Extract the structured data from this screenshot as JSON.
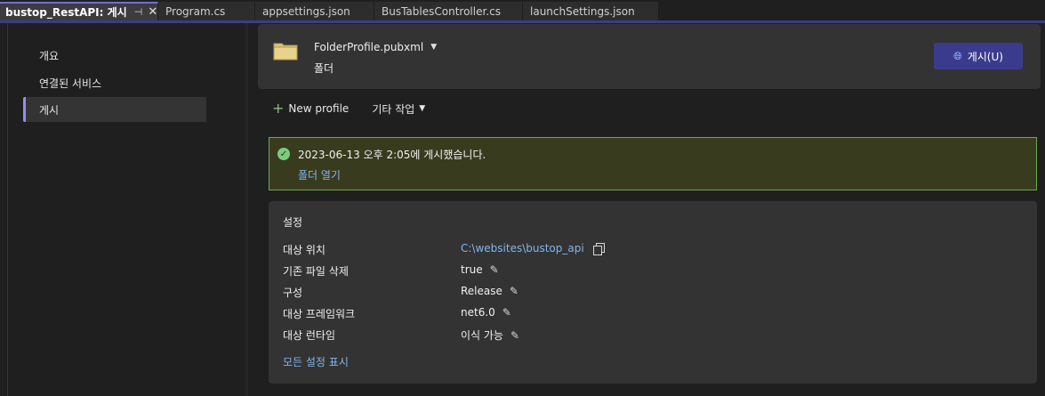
{
  "tabs": [
    {
      "label": "bustop_RestAPI: 게시",
      "active": true,
      "pin": "⊣",
      "close": "✕"
    },
    {
      "label": "Program.cs",
      "active": false
    },
    {
      "label": "appsettings.json",
      "active": false
    },
    {
      "label": "BusTablesController.cs",
      "active": false
    },
    {
      "label": "launchSettings.json",
      "active": false
    }
  ],
  "sidebar": {
    "items": [
      {
        "label": "개요",
        "selected": false
      },
      {
        "label": "연결된 서비스",
        "selected": false
      },
      {
        "label": "게시",
        "selected": true
      }
    ]
  },
  "header": {
    "profile_name": "FolderProfile.pubxml",
    "profile_type": "폴더",
    "publish_label": "게시(U)",
    "folder_icon": "folder-icon",
    "publish_icon": "globe-icon"
  },
  "toolbar": {
    "new_profile_label": "New profile",
    "other_actions_label": "기타 작업"
  },
  "status": {
    "message": "2023-06-13 오후 2:05에 게시했습니다.",
    "open_folder_label": "폴더 열기",
    "accent_color": "#6aaa4a"
  },
  "settings": {
    "title": "설정",
    "rows": [
      {
        "label": "대상 위치",
        "value": "C:\\websites\\bustop_api",
        "action": "copy"
      },
      {
        "label": "기존 파일 삭제",
        "value": "true",
        "action": "edit"
      },
      {
        "label": "구성",
        "value": "Release",
        "action": "edit"
      },
      {
        "label": "대상 프레임워크",
        "value": "net6.0",
        "action": "edit"
      },
      {
        "label": "대상 런타임",
        "value": "이식 가능",
        "action": "edit"
      }
    ],
    "show_all_label": "모든 설정 표시"
  },
  "colors": {
    "accent": "#3b3b8e",
    "link": "#7fb6ee",
    "success_border": "#6aaa4a"
  }
}
